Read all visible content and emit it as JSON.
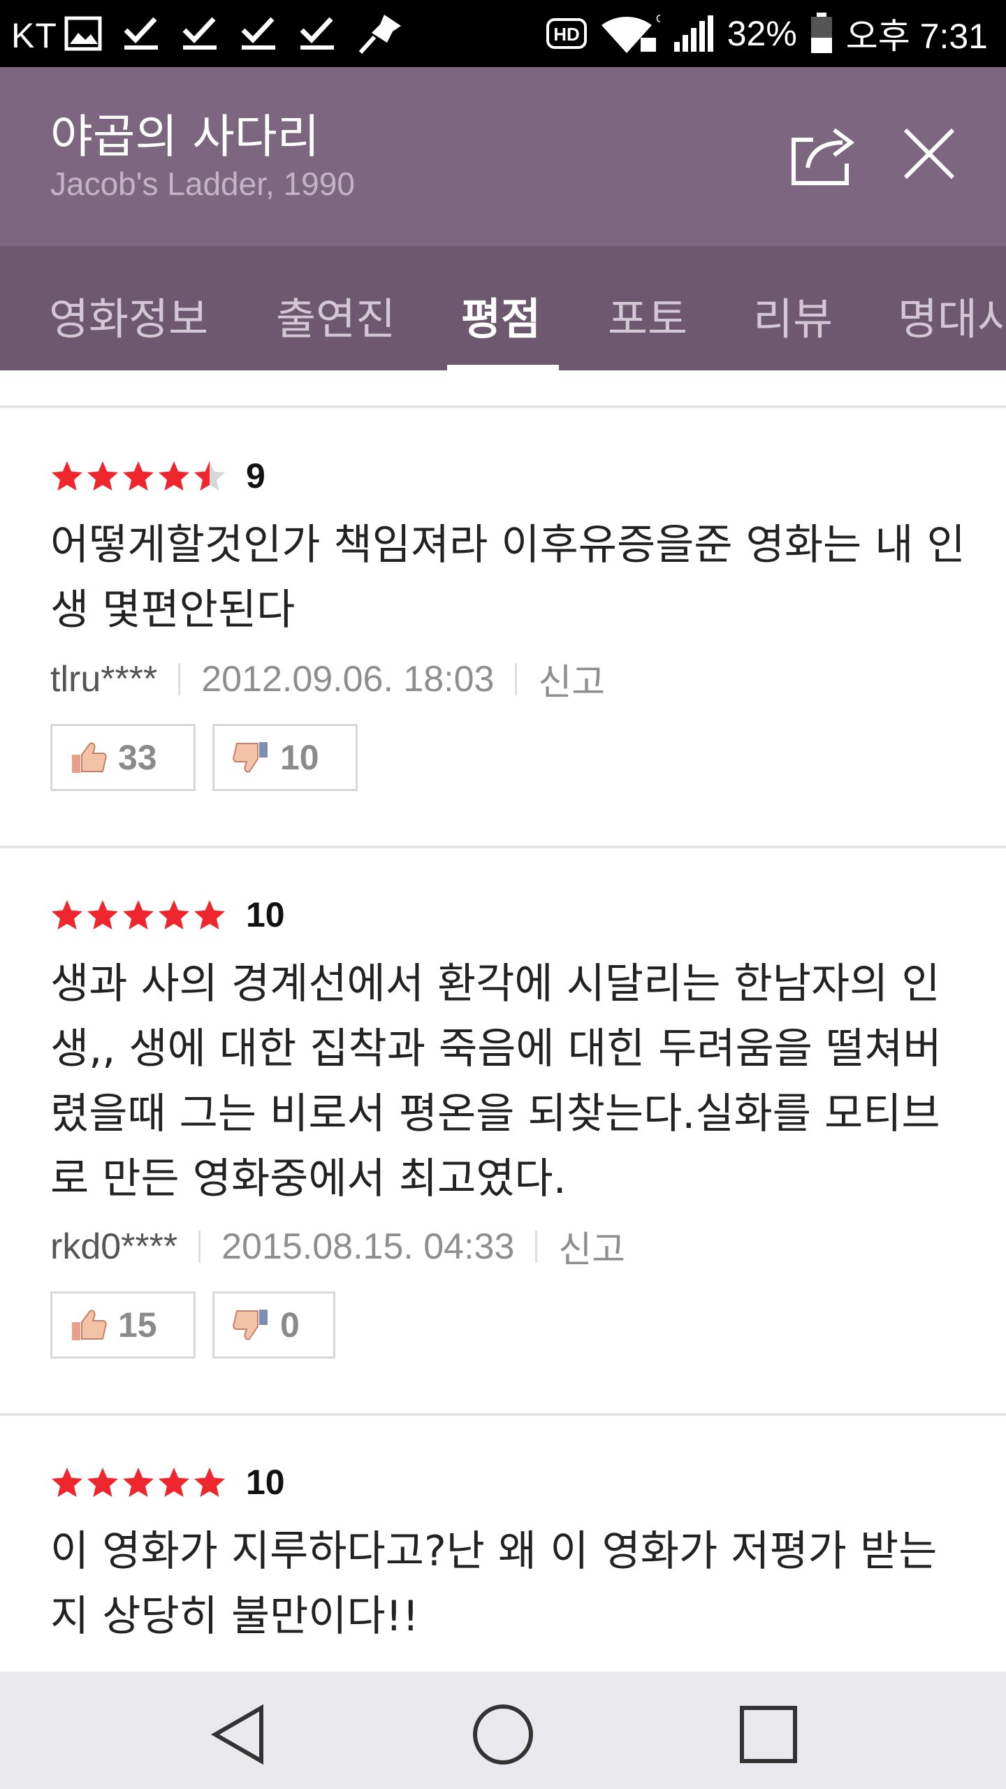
{
  "status_bar": {
    "carrier": "KT",
    "battery": "32%",
    "time": "오후 7:31",
    "icons": [
      "image-icon",
      "check-icon",
      "check-icon",
      "check-icon",
      "check-icon",
      "pin-icon",
      "hd-icon",
      "wifi-icon",
      "signal-icon",
      "battery-icon"
    ]
  },
  "header": {
    "title": "야곱의 사다리",
    "subtitle": "Jacob's Ladder, 1990"
  },
  "tabs": [
    {
      "label": "영화정보"
    },
    {
      "label": "출연진"
    },
    {
      "label": "평점"
    },
    {
      "label": "포토"
    },
    {
      "label": "리뷰"
    },
    {
      "label": "명대사"
    }
  ],
  "active_tab": "평점",
  "colors": {
    "header_bg": "#7d6680",
    "tab_bg": "#6d5870",
    "star": "#f0262e",
    "star_empty": "#d7d7d7"
  },
  "reviews": [
    {
      "score": "9",
      "stars": 4.5,
      "text": "어떻게할것인가 책임져라 이후유증을준 영화는 내 인생 몇편안된다",
      "user": "tlru****",
      "date": "2012.09.06. 18:03",
      "report": "신고",
      "likes": "33",
      "dislikes": "10"
    },
    {
      "score": "10",
      "stars": 5,
      "text": "생과 사의 경계선에서 환각에 시달리는 한남자의 인생,, 생에 대한 집착과 죽음에 대힌 두려움을 떨쳐버렸을때 그는 비로서 평온을 되찾는다.실화를 모티브로 만든 영화중에서 최고였다.",
      "user": "rkd0****",
      "date": "2015.08.15. 04:33",
      "report": "신고",
      "likes": "15",
      "dislikes": "0"
    },
    {
      "score": "10",
      "stars": 5,
      "text": "이 영화가 지루하다고?난 왜 이 영화가 저평가 받는지 상당히 불만이다!!",
      "user": "",
      "date": "",
      "report": "",
      "likes": "",
      "dislikes": ""
    }
  ],
  "navbar": {
    "icons": [
      "back-icon",
      "home-icon",
      "recents-icon"
    ]
  }
}
